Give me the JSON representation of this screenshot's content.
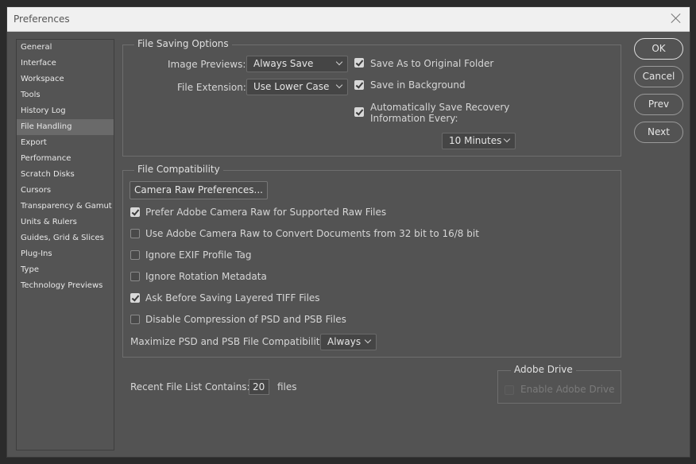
{
  "window": {
    "title": "Preferences"
  },
  "sidebar": {
    "items": [
      {
        "label": "General"
      },
      {
        "label": "Interface"
      },
      {
        "label": "Workspace"
      },
      {
        "label": "Tools"
      },
      {
        "label": "History Log"
      },
      {
        "label": "File Handling",
        "selected": true
      },
      {
        "label": "Export"
      },
      {
        "label": "Performance"
      },
      {
        "label": "Scratch Disks"
      },
      {
        "label": "Cursors"
      },
      {
        "label": "Transparency & Gamut"
      },
      {
        "label": "Units & Rulers"
      },
      {
        "label": "Guides, Grid & Slices"
      },
      {
        "label": "Plug-Ins"
      },
      {
        "label": "Type"
      },
      {
        "label": "Technology Previews"
      }
    ]
  },
  "file_saving": {
    "title": "File Saving Options",
    "image_previews_label": "Image Previews:",
    "image_previews_value": "Always Save",
    "file_extension_label": "File Extension:",
    "file_extension_value": "Use Lower Case",
    "save_as_original": {
      "label": "Save As to Original Folder",
      "checked": true
    },
    "save_in_background": {
      "label": "Save in Background",
      "checked": true
    },
    "auto_save": {
      "label_line1": "Automatically Save Recovery",
      "label_line2": "Information Every:",
      "checked": true
    },
    "auto_save_interval": "10 Minutes"
  },
  "file_compat": {
    "title": "File Compatibility",
    "camera_raw_button": "Camera Raw Preferences...",
    "options": [
      {
        "label": "Prefer Adobe Camera Raw for Supported Raw Files",
        "checked": true
      },
      {
        "label": "Use Adobe Camera Raw to Convert Documents from 32 bit to 16/8 bit",
        "checked": false
      },
      {
        "label": "Ignore EXIF Profile Tag",
        "checked": false
      },
      {
        "label": "Ignore Rotation Metadata",
        "checked": false
      },
      {
        "label": "Ask Before Saving Layered TIFF Files",
        "checked": true
      },
      {
        "label": "Disable Compression of PSD and PSB Files",
        "checked": false
      }
    ],
    "maximize_label": "Maximize PSD and PSB File Compatibility:",
    "maximize_value": "Always"
  },
  "recent": {
    "label": "Recent File List Contains:",
    "value": "20",
    "suffix": "files"
  },
  "adobe_drive": {
    "title": "Adobe Drive",
    "enable_label": "Enable Adobe Drive",
    "enabled": false
  },
  "buttons": {
    "ok": "OK",
    "cancel": "Cancel",
    "prev": "Prev",
    "next": "Next"
  }
}
